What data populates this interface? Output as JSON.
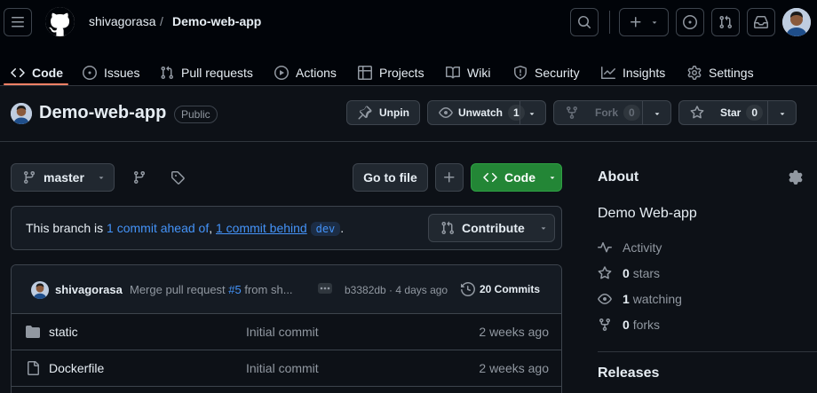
{
  "header": {
    "owner": "shivagorasa",
    "separator": "/",
    "repo": "Demo-web-app",
    "plus_label": "+"
  },
  "tabs": [
    {
      "label": "Code",
      "icon": "code-icon",
      "active": true
    },
    {
      "label": "Issues",
      "icon": "issue-opened-icon"
    },
    {
      "label": "Pull requests",
      "icon": "git-pull-request-icon"
    },
    {
      "label": "Actions",
      "icon": "play-icon"
    },
    {
      "label": "Projects",
      "icon": "table-icon"
    },
    {
      "label": "Wiki",
      "icon": "book-icon"
    },
    {
      "label": "Security",
      "icon": "shield-icon"
    },
    {
      "label": "Insights",
      "icon": "graph-icon"
    },
    {
      "label": "Settings",
      "icon": "gear-icon"
    }
  ],
  "repo": {
    "name": "Demo-web-app",
    "visibility": "Public",
    "unpin_label": "Unpin",
    "unwatch_label": "Unwatch",
    "watch_count": "1",
    "fork_label": "Fork",
    "fork_count": "0",
    "star_label": "Star",
    "star_count": "0"
  },
  "toolbar": {
    "branch": "master",
    "go_to_file": "Go to file",
    "add_label": "+",
    "code_label": "Code"
  },
  "branch_status": {
    "prefix": "This branch is ",
    "ahead": "1 commit ahead of",
    "comma": ", ",
    "behind": "1 commit behind",
    "target": "dev",
    "suffix": ".",
    "contribute_label": "Contribute"
  },
  "latest_commit": {
    "author": "shivagorasa",
    "message_prefix": "Merge pull request ",
    "pr_link": "#5",
    "message_suffix": " from sh...",
    "sha_and_time": "b3382db · 4 days ago",
    "commits_label": "20 Commits"
  },
  "files": [
    {
      "name": "static",
      "type": "folder",
      "message": "Initial commit",
      "age": "2 weeks ago"
    },
    {
      "name": "Dockerfile",
      "type": "file",
      "message": "Initial commit",
      "age": "2 weeks ago"
    }
  ],
  "about": {
    "title": "About",
    "description": "Demo Web-app",
    "activity": "Activity",
    "stars_count": "0",
    "stars_label": "stars",
    "watching_count": "1",
    "watching_label": "watching",
    "forks_count": "0",
    "forks_label": "forks",
    "releases_title": "Releases"
  },
  "colors": {
    "accent_green": "#238636",
    "link_blue": "#4493f8",
    "active_tab_underline": "#f78166",
    "background": "#0d1117"
  }
}
